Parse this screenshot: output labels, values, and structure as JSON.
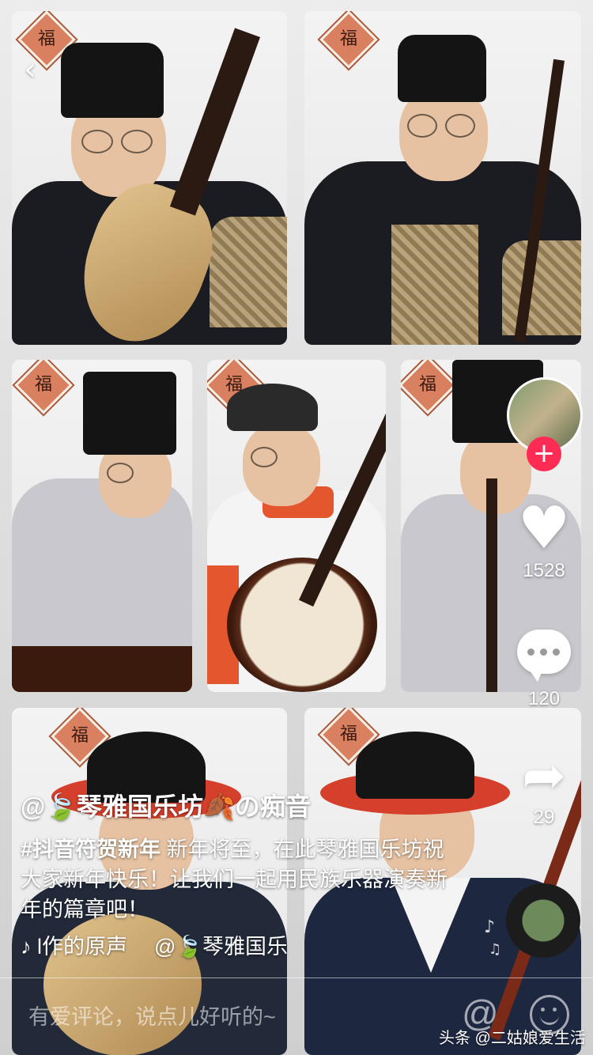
{
  "video": {
    "panels": [
      {
        "name": "pipa-player"
      },
      {
        "name": "erhu-player"
      },
      {
        "name": "guzheng-player"
      },
      {
        "name": "ruan-player"
      },
      {
        "name": "flute-player"
      },
      {
        "name": "bottom-left-player"
      },
      {
        "name": "bottom-right-player"
      }
    ]
  },
  "sidebar": {
    "like_count": "1528",
    "comment_count": "120",
    "share_count": "29",
    "follow_symbol": "+"
  },
  "caption": {
    "author": "@🍃琴雅国乐坊🍂の痴音",
    "hashtag": "#抖音符贺新年",
    "text": " 新年将至，在此琴雅国乐坊祝大家新年快乐！让我们一起用民族乐器演奏新年的篇章吧！"
  },
  "music": {
    "note_symbol": "♪",
    "title": "l作的原声",
    "author": "@🍃琴雅国乐"
  },
  "comment_bar": {
    "placeholder": "有爱评论，说点儿好听的~",
    "at_symbol": "@"
  },
  "watermark": "头条 @二姑娘爱生活",
  "icons": {
    "back": "back-chevron-icon",
    "like": "heart-icon",
    "comment": "comment-bubble-icon",
    "share": "share-arrow-icon",
    "music": "music-note-icon",
    "emoji": "emoji-icon"
  },
  "colors": {
    "follow_red": "#fe2c55",
    "fu_sign": "#d8805f"
  }
}
